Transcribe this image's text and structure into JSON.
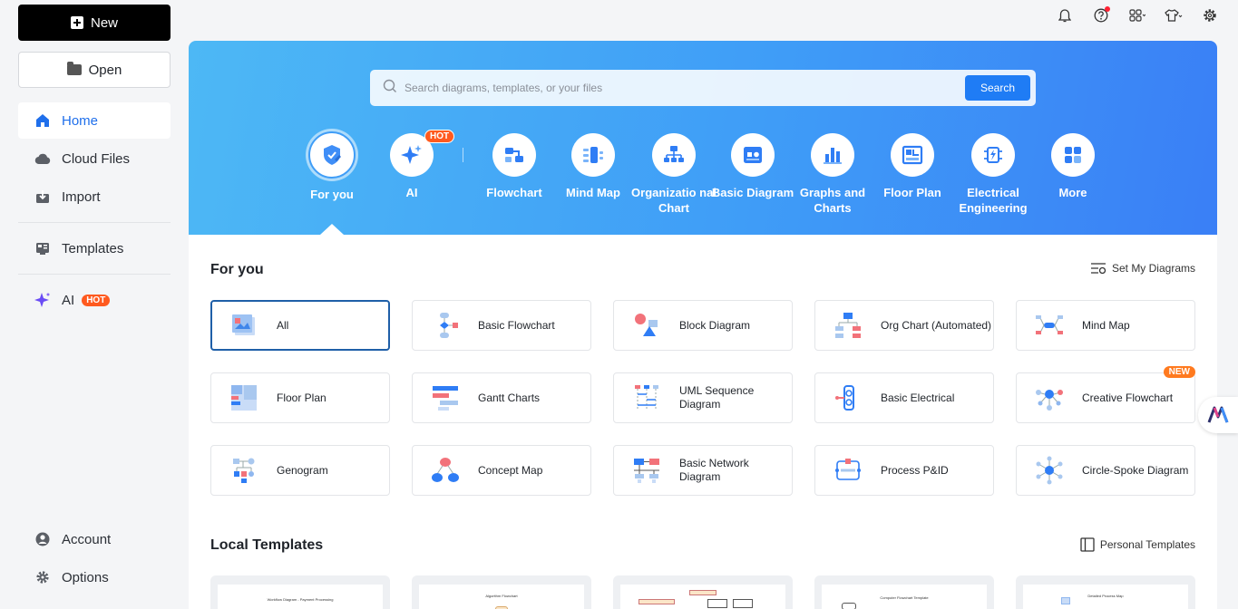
{
  "sidebar": {
    "new_label": "New",
    "open_label": "Open",
    "items": [
      {
        "label": "Home"
      },
      {
        "label": "Cloud Files"
      },
      {
        "label": "Import"
      },
      {
        "label": "Templates"
      },
      {
        "label": "AI",
        "badge": "HOT"
      }
    ],
    "bottom": [
      {
        "label": "Account"
      },
      {
        "label": "Options"
      }
    ]
  },
  "search": {
    "placeholder": "Search diagrams, templates, or your files",
    "button_label": "Search"
  },
  "categories": [
    {
      "label": "For you",
      "selected": true
    },
    {
      "label": "AI",
      "badge": "HOT"
    },
    {
      "label": "Flowchart"
    },
    {
      "label": "Mind Map"
    },
    {
      "label": "Organizatio nal Chart"
    },
    {
      "label": "Basic Diagram"
    },
    {
      "label": "Graphs and Charts"
    },
    {
      "label": "Floor Plan"
    },
    {
      "label": "Electrical Engineering"
    },
    {
      "label": "More"
    }
  ],
  "for_you": {
    "title": "For you",
    "link_label": "Set My Diagrams",
    "cards": [
      {
        "label": "All",
        "selected": true
      },
      {
        "label": "Basic Flowchart"
      },
      {
        "label": "Block Diagram"
      },
      {
        "label": "Org Chart (Automated)"
      },
      {
        "label": "Mind Map"
      },
      {
        "label": "Floor Plan"
      },
      {
        "label": "Gantt Charts"
      },
      {
        "label": "UML Sequence Diagram"
      },
      {
        "label": "Basic Electrical"
      },
      {
        "label": "Creative Flowchart",
        "badge": "NEW"
      },
      {
        "label": "Genogram"
      },
      {
        "label": "Concept Map"
      },
      {
        "label": "Basic Network Diagram"
      },
      {
        "label": "Process P&ID"
      },
      {
        "label": "Circle-Spoke Diagram"
      }
    ]
  },
  "local_templates": {
    "title": "Local Templates",
    "link_label": "Personal Templates",
    "items": [
      {
        "caption": "Workflow Diagram - Payment Processing"
      },
      {
        "caption": "Algorithm Flowchart"
      },
      {
        "caption": ""
      },
      {
        "caption": "Computer Flowchart Template"
      },
      {
        "caption": "Detailed Process Map"
      }
    ]
  },
  "colors": {
    "accent": "#1f7cf5",
    "hot": "#ff5a1f",
    "hero_start": "#4db8f5",
    "hero_end": "#3a7ff6"
  }
}
